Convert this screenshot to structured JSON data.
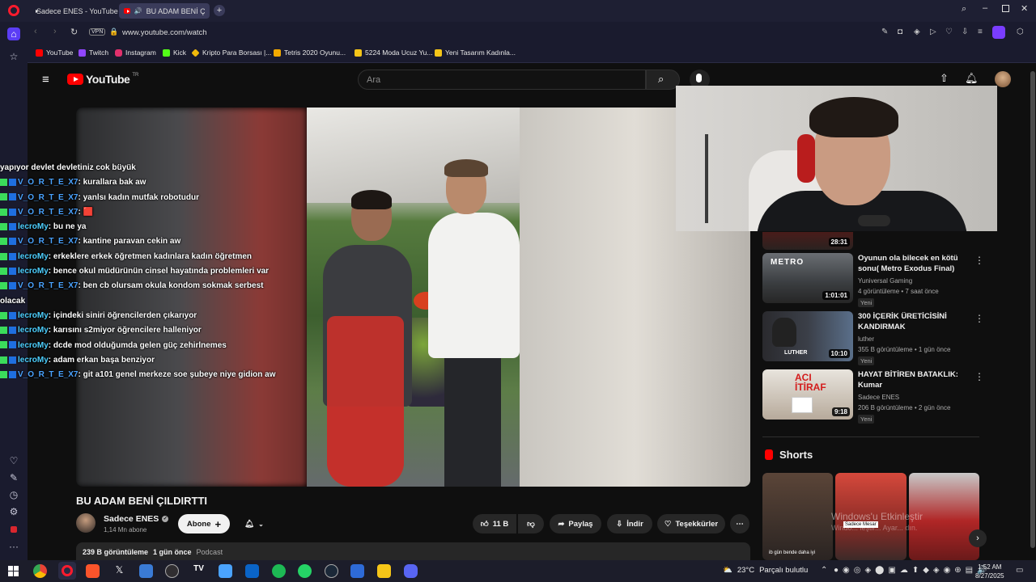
{
  "browser": {
    "tabs": [
      {
        "label": "Sadece ENES - YouTube",
        "active": false
      },
      {
        "label": "BU ADAM BENİ ÇILDIF",
        "active": true
      }
    ],
    "url": "www.youtube.com/watch",
    "vpn_label": "VPN",
    "bookmarks": [
      {
        "label": "YouTube",
        "icon": "youtube-icon",
        "color": "#ff0000"
      },
      {
        "label": "Twitch",
        "icon": "twitch-icon",
        "color": "#9146ff"
      },
      {
        "label": "Instagram",
        "icon": "instagram-icon",
        "color": "#e1306c"
      },
      {
        "label": "Kick",
        "icon": "kick-icon",
        "color": "#53fc18"
      },
      {
        "label": "Kripto Para Borsası |...",
        "icon": "binance-icon",
        "color": "#f0b90b"
      },
      {
        "label": "Tetris 2020 Oyunu...",
        "icon": "tetris-icon",
        "color": "#f2a900"
      },
      {
        "label": "5224 Moda Ucuz Yu...",
        "icon": "folder-icon",
        "color": "#f5c518"
      },
      {
        "label": "Yeni Tasarım Kadınla...",
        "icon": "folder-icon",
        "color": "#f5c518"
      }
    ]
  },
  "youtube": {
    "logo_text": "YouTube",
    "logo_region": "TR",
    "search_placeholder": "Ara",
    "video": {
      "title": "BU ADAM BENİ ÇILDIRTTI",
      "channel": "Sadece ENES",
      "subscribers": "1,14 Mn abone",
      "subscribe_label": "Abone",
      "likes": "11 B",
      "share_label": "Paylaş",
      "download_label": "İndir",
      "thanks_label": "Teşekkürler",
      "views": "239 B görüntüleme",
      "date": "1 gün önce",
      "tag": "Podcast"
    },
    "recommendations": [
      {
        "duration": "28:31"
      },
      {
        "title": "Oyunun ola bilecek en kötü sonu( Metro Exodus Final)",
        "channel": "Yuniversal Gaming",
        "meta": "4 görüntüleme • 7 saat önce",
        "badge": "Yeni",
        "duration": "1:01:01",
        "thumb_text": "METRO"
      },
      {
        "title": "300 İÇERİK ÜRETİCİSİNİ KANDIRMAK",
        "channel": "luther",
        "meta": "355 B görüntüleme • 1 gün önce",
        "badge": "Yeni",
        "duration": "10:10",
        "thumb_text": "LUTHER"
      },
      {
        "title": "HAYAT BİTİREN BATAKLIK: Kumar",
        "channel": "Sadece ENES",
        "meta": "206 B görüntüleme • 2 gün önce",
        "badge": "Yeni",
        "duration": "9:18",
        "thumb_text": "ACI İTİRAF"
      }
    ],
    "shorts_label": "Shorts",
    "shorts_overlay": "Windows'u Etkinleştir",
    "shorts_caption": "ib gün bende daha iyi",
    "shorts_badge": "Sadece Mesar",
    "shorts_overlay2": "Windo... leştir... Ayar... dın."
  },
  "chat": [
    {
      "user": "",
      "text": "yapıyor devlet devletiniz cok büyük",
      "badges": 0
    },
    {
      "user": "V_O_R_T_E_X7",
      "text": ": kurallara bak aw",
      "badges": 2
    },
    {
      "user": "V_O_R_T_E_X7",
      "text": ": yanlsı kadın mutfak robotudur",
      "badges": 2
    },
    {
      "user": "V_O_R_T_E_X7",
      "text": ": 🟥",
      "badges": 2
    },
    {
      "user": "lecroMy",
      "text": ": bu ne ya",
      "badges": 2
    },
    {
      "user": "V_O_R_T_E_X7",
      "text": ": kantine paravan cekin aw",
      "badges": 2
    },
    {
      "user": "lecroMy",
      "text": ": erkeklere erkek öğretmen kadınlara kadın öğretmen",
      "badges": 2
    },
    {
      "user": "lecroMy",
      "text": ": bence okul müdürünün cinsel hayatında problemleri var",
      "badges": 2
    },
    {
      "user": "V_O_R_T_E_X7",
      "text": ": ben cb olursam okula kondom sokmak serbest",
      "badges": 2
    },
    {
      "user": "",
      "text": "olacak",
      "badges": 0
    },
    {
      "user": "lecroMy",
      "text": ": içindeki siniri öğrencilerden çıkarıyor",
      "badges": 2
    },
    {
      "user": "lecroMy",
      "text": ": karısını s2miyor öğrencilere halleniyor",
      "badges": 2
    },
    {
      "user": "lecroMy",
      "text": ": dcde mod olduğumda gelen güç zehirlnemes",
      "badges": 2
    },
    {
      "user": "lecroMy",
      "text": ": adam erkan başa benziyor",
      "badges": 2
    },
    {
      "user": "V_O_R_T_E_X7",
      "text": ": git a101 genel merkeze soe şubeye niye gidion aw",
      "badges": 2
    }
  ],
  "taskbar": {
    "weather": "23°C",
    "weather_text": "Parçalı bulutlu",
    "time": "1:52 AM",
    "date": "8/27/2025"
  }
}
